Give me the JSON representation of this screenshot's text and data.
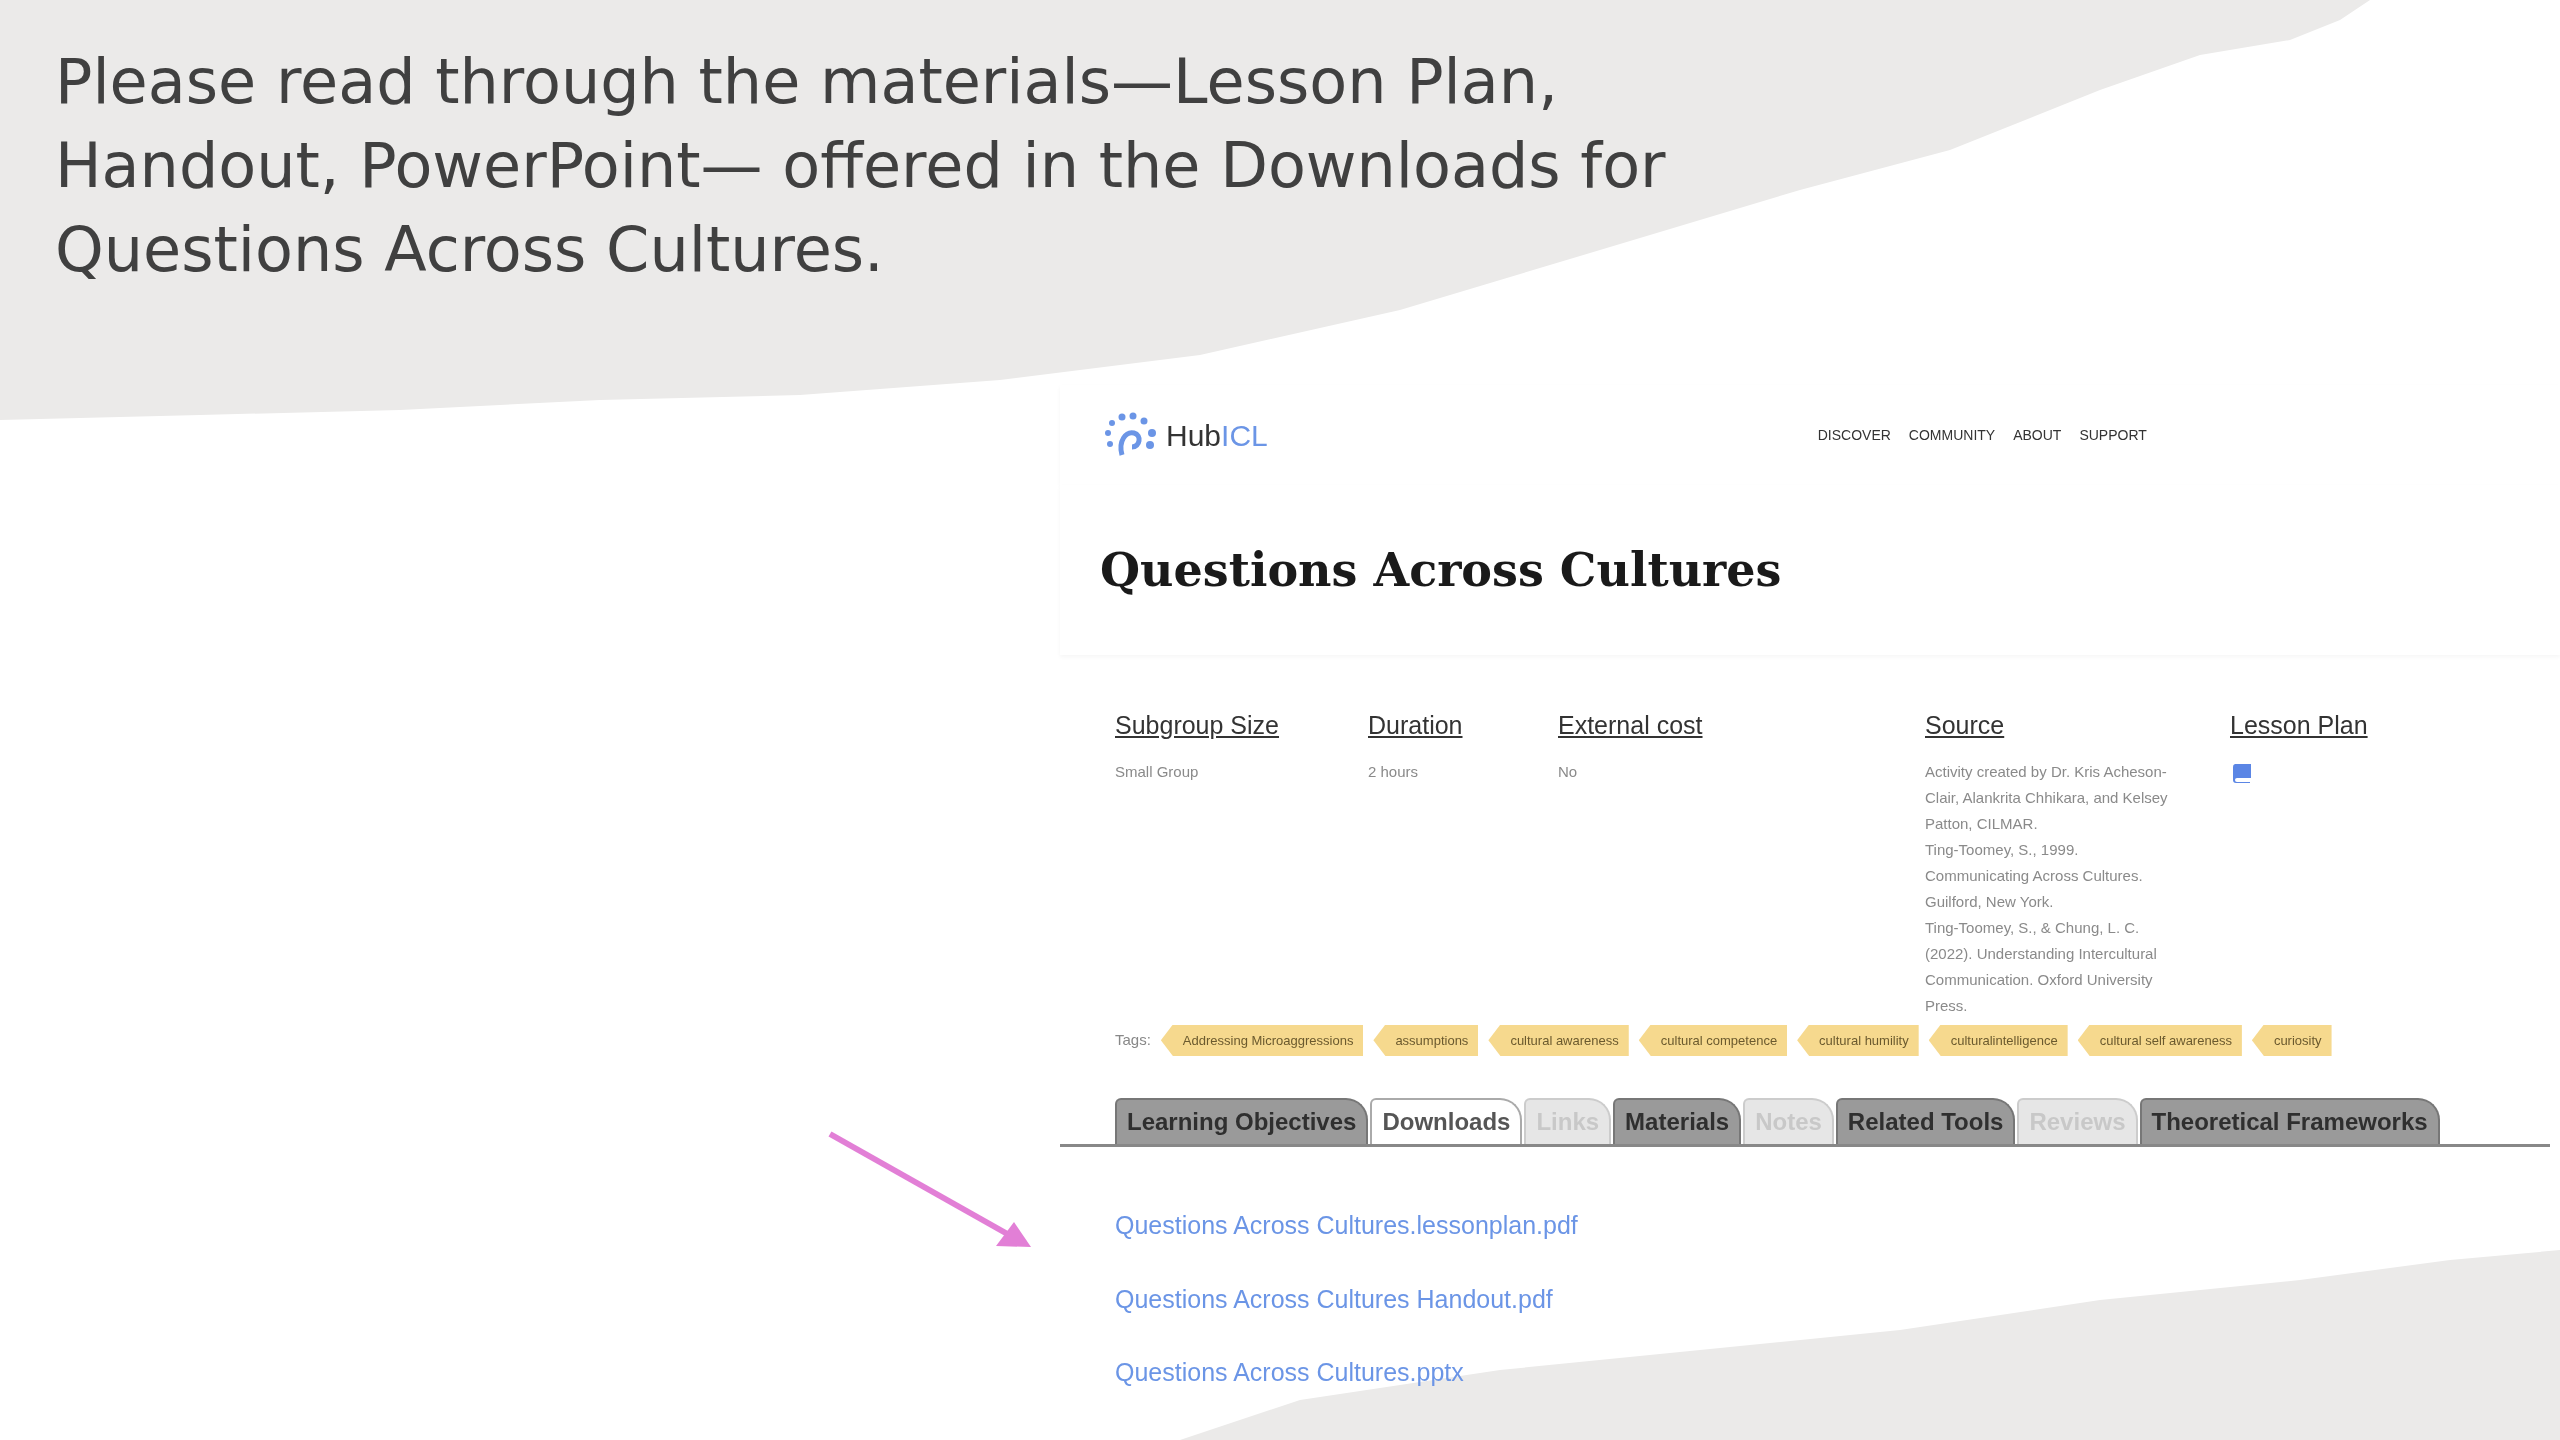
{
  "slide": {
    "heading": "Please read through the materials—Lesson Plan, Handout, PowerPoint— offered in the Downloads for Questions Across Cultures."
  },
  "site": {
    "logo_text": "Hub",
    "logo_accent": "ICL",
    "nav": [
      "DISCOVER",
      "COMMUNITY",
      "ABOUT",
      "SUPPORT"
    ]
  },
  "page_title": "Questions Across Cultures",
  "info": [
    {
      "kind": "text",
      "heading": "Subgroup Size",
      "values": [
        "Small Group"
      ]
    },
    {
      "kind": "text",
      "heading": "Duration",
      "values": [
        "2 hours"
      ]
    },
    {
      "kind": "text",
      "heading": "External cost",
      "values": [
        "No"
      ]
    },
    {
      "kind": "text",
      "heading": "Source",
      "values": [
        "Activity created by Dr. Kris Acheson-Clair, Alankrita Chhikara, and Kelsey Patton, CILMAR.",
        "Ting-Toomey, S., 1999. Communicating Across Cultures. Guilford, New York.",
        "Ting-Toomey, S., & Chung, L. C. (2022). Understanding Intercultural Communication. Oxford University Press."
      ]
    },
    {
      "kind": "icon",
      "heading": "Lesson Plan"
    }
  ],
  "tags_label": "Tags:",
  "tags": [
    "Addressing Microaggressions",
    "assumptions",
    "cultural awareness",
    "cultural competence",
    "cultural humility",
    "culturalintelligence",
    "cultural self awareness",
    "curiosity"
  ],
  "tabs": [
    {
      "label": "Learning Objectives",
      "selected": false,
      "disabled": false
    },
    {
      "label": "Downloads",
      "selected": true,
      "disabled": false
    },
    {
      "label": "Links",
      "selected": false,
      "disabled": true
    },
    {
      "label": "Materials",
      "selected": false,
      "disabled": false
    },
    {
      "label": "Notes",
      "selected": false,
      "disabled": true
    },
    {
      "label": "Related Tools",
      "selected": false,
      "disabled": false
    },
    {
      "label": "Reviews",
      "selected": false,
      "disabled": true
    },
    {
      "label": "Theoretical Frameworks",
      "selected": false,
      "disabled": false
    }
  ],
  "downloads": [
    "Questions Across Cultures.lessonplan.pdf",
    "Questions Across Cultures Handout.pdf",
    "Questions Across Cultures.pptx"
  ]
}
